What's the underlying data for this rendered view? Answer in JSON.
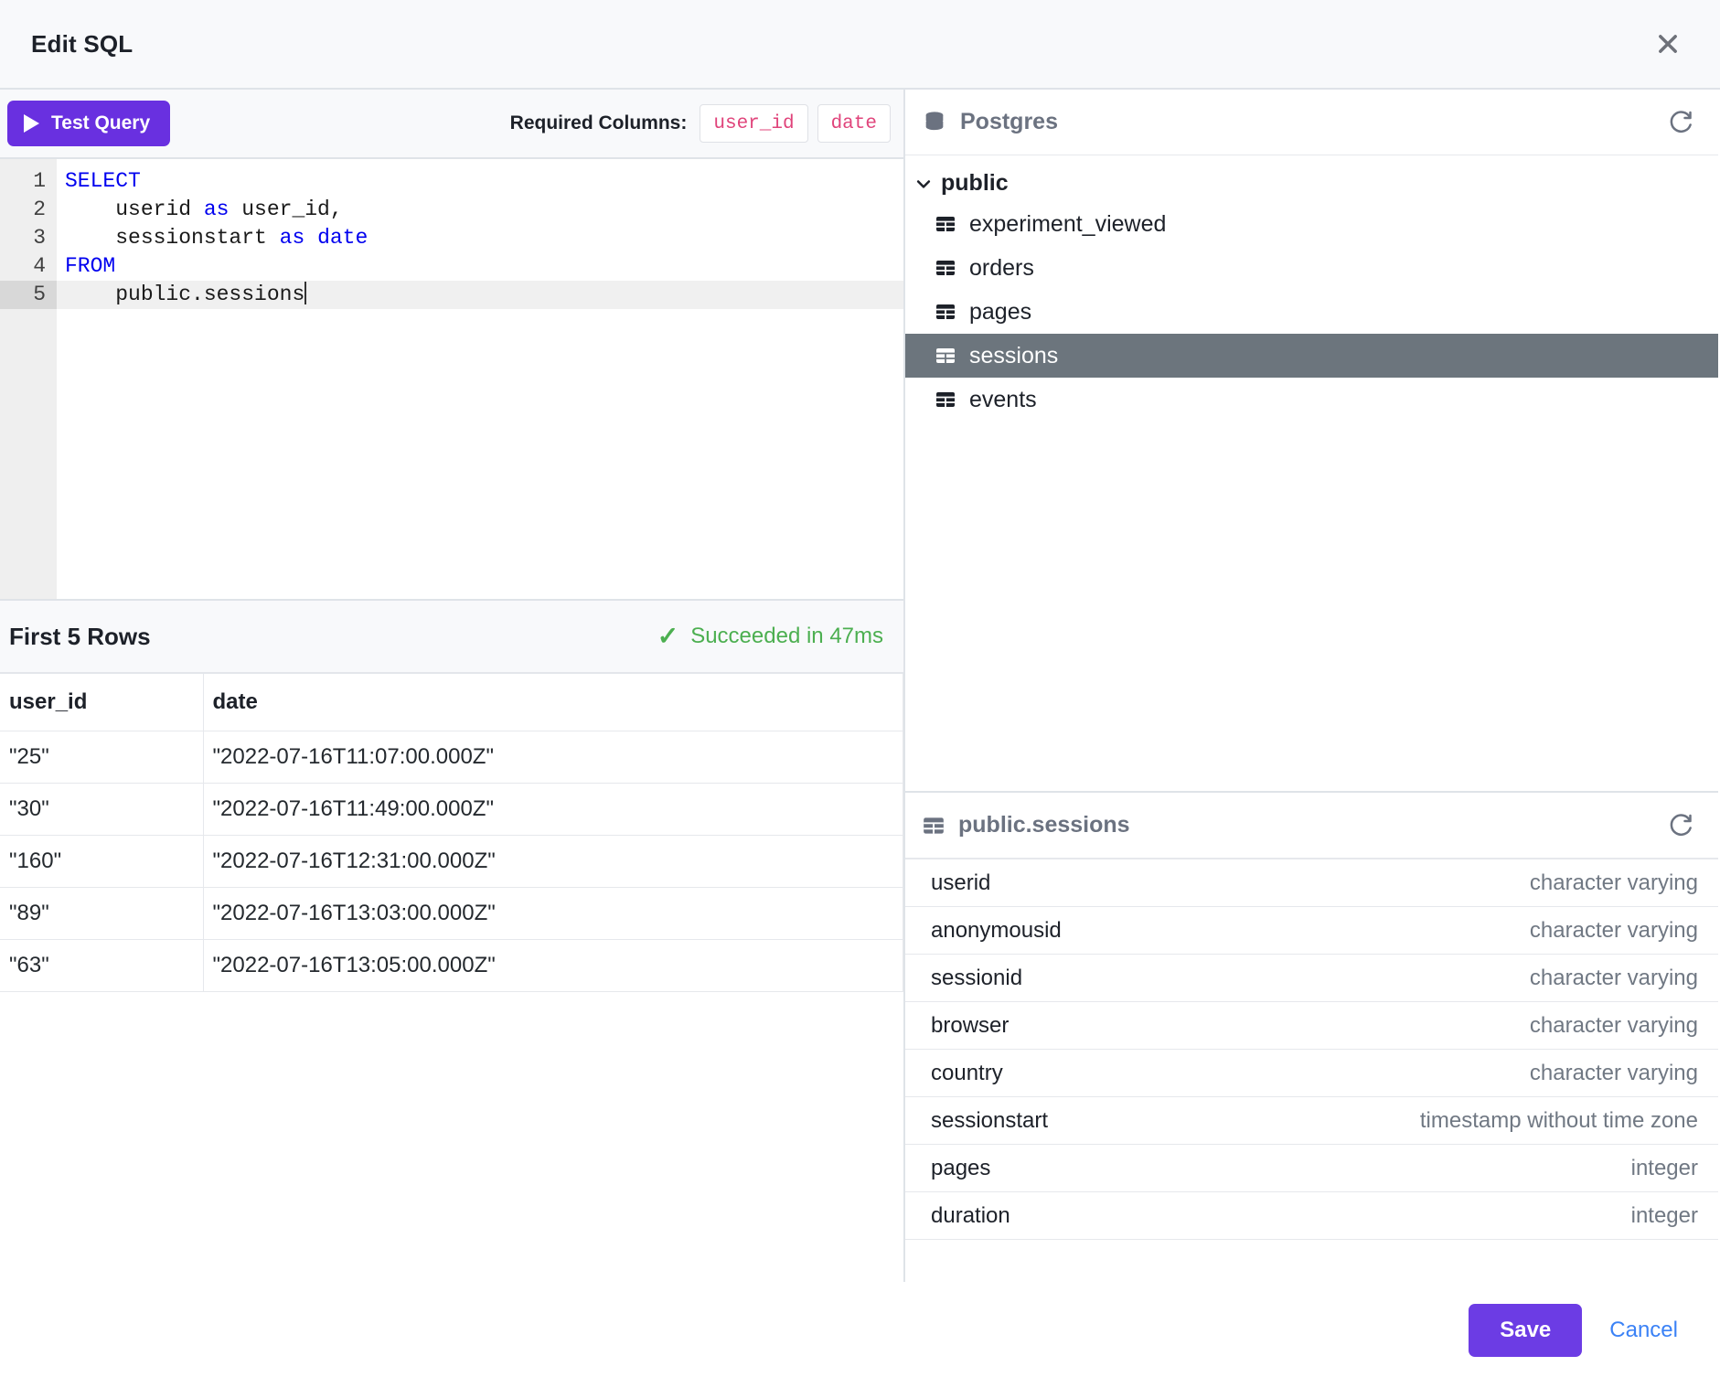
{
  "dialog": {
    "title": "Edit SQL",
    "close_icon": "close-icon"
  },
  "toolbar": {
    "test_query_label": "Test Query",
    "play_icon": "play-icon",
    "required_columns_label": "Required Columns:",
    "required_columns": [
      "user_id",
      "date"
    ],
    "accent_color": "#6930e0",
    "badge_text_color": "#e0447b"
  },
  "editor": {
    "lines": [
      {
        "n": "1",
        "tokens": [
          {
            "t": "SELECT",
            "kw": true
          }
        ]
      },
      {
        "n": "2",
        "tokens": [
          {
            "t": "    userid "
          },
          {
            "t": "as",
            "kw": true
          },
          {
            "t": " user_id,"
          }
        ]
      },
      {
        "n": "3",
        "tokens": [
          {
            "t": "    sessionstart "
          },
          {
            "t": "as",
            "kw": true
          },
          {
            "t": " "
          },
          {
            "t": "date",
            "kw": true
          }
        ]
      },
      {
        "n": "4",
        "tokens": [
          {
            "t": "FROM",
            "kw": true
          }
        ]
      },
      {
        "n": "5",
        "tokens": [
          {
            "t": "    public.sessions"
          }
        ],
        "active": true,
        "caret": true
      }
    ],
    "keyword_color": "#0000ef"
  },
  "results": {
    "title": "First 5 Rows",
    "status_icon": "check-icon",
    "status_text": "Succeeded in 47ms",
    "status_color": "#4caf50",
    "columns": [
      "user_id",
      "date"
    ],
    "rows": [
      [
        "\"25\"",
        "\"2022-07-16T11:07:00.000Z\""
      ],
      [
        "\"30\"",
        "\"2022-07-16T11:49:00.000Z\""
      ],
      [
        "\"160\"",
        "\"2022-07-16T12:31:00.000Z\""
      ],
      [
        "\"89\"",
        "\"2022-07-16T13:03:00.000Z\""
      ],
      [
        "\"63\"",
        "\"2022-07-16T13:05:00.000Z\""
      ]
    ]
  },
  "schema_panel": {
    "db_icon": "database-icon",
    "db_name": "Postgres",
    "refresh_icon": "refresh-icon",
    "schema_name": "public",
    "chevron_icon": "chevron-down-icon",
    "tables": [
      {
        "name": "experiment_viewed",
        "selected": false
      },
      {
        "name": "orders",
        "selected": false
      },
      {
        "name": "pages",
        "selected": false
      },
      {
        "name": "sessions",
        "selected": true
      },
      {
        "name": "events",
        "selected": false
      }
    ],
    "selected_bg": "#6c757d"
  },
  "columns_panel": {
    "table_icon": "table-icon",
    "title": "public.sessions",
    "refresh_icon": "refresh-icon",
    "columns": [
      {
        "name": "userid",
        "type": "character varying"
      },
      {
        "name": "anonymousid",
        "type": "character varying"
      },
      {
        "name": "sessionid",
        "type": "character varying"
      },
      {
        "name": "browser",
        "type": "character varying"
      },
      {
        "name": "country",
        "type": "character varying"
      },
      {
        "name": "sessionstart",
        "type": "timestamp without time zone"
      },
      {
        "name": "pages",
        "type": "integer"
      },
      {
        "name": "duration",
        "type": "integer"
      }
    ]
  },
  "footer": {
    "save_label": "Save",
    "cancel_label": "Cancel",
    "save_color": "#6c3ce4",
    "cancel_color": "#3b82f6"
  }
}
